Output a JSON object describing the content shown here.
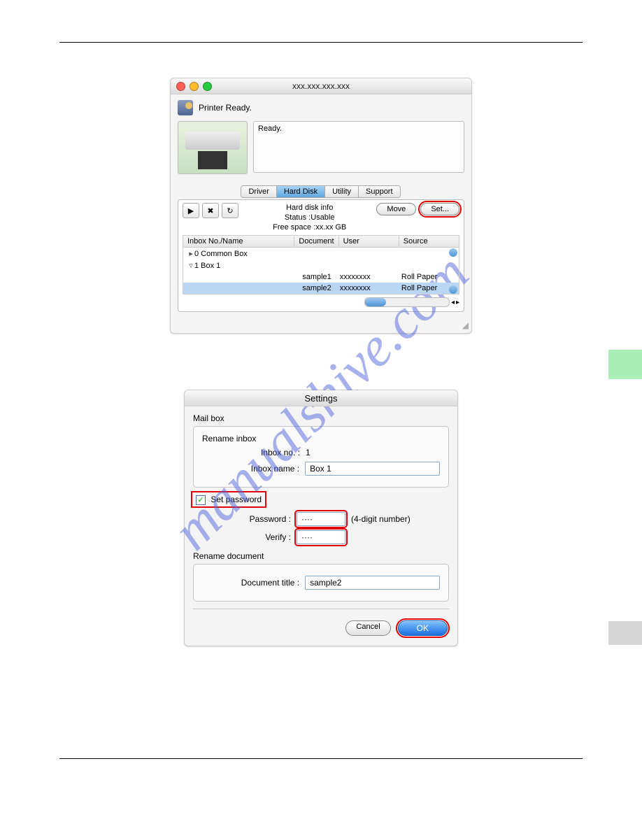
{
  "watermark": "manualshive.com",
  "window1": {
    "title": "xxx.xxx.xxx.xxx",
    "printer_ready_label": "Printer Ready.",
    "ready_box_text": "Ready.",
    "tabs": {
      "driver": "Driver",
      "hard_disk": "Hard Disk",
      "utility": "Utility",
      "support": "Support"
    },
    "hd_info_label": "Hard disk info",
    "status_label": "Status :Usable",
    "free_space_label": "Free space :xx.xx GB",
    "move_btn": "Move",
    "set_btn": "Set...",
    "columns": {
      "c1": "Inbox No./Name",
      "c2": "Document",
      "c3": "User",
      "c4": "Source"
    },
    "rows": {
      "r0_name": "0 Common Box",
      "r1_name": "1 Box 1",
      "r2_doc": "sample1",
      "r2_user": "xxxxxxxx",
      "r2_src": "Roll Paper",
      "r3_doc": "sample2",
      "r3_user": "xxxxxxxx",
      "r3_src": "Roll Paper"
    },
    "toolbar": {
      "play": "▶",
      "clear": "✖",
      "refresh": "↻"
    }
  },
  "settings": {
    "title": "Settings",
    "mailbox_label": "Mail box",
    "rename_inbox_label": "Rename inbox",
    "inbox_no_label": "Inbox no. :",
    "inbox_no_value": "1",
    "inbox_name_label": "Inbox name :",
    "inbox_name_value": "Box 1",
    "set_password_label": "Set password",
    "password_label": "Password :",
    "password_value": "····",
    "password_hint": "(4-digit number)",
    "verify_label": "Verify :",
    "verify_value": "····",
    "rename_doc_label": "Rename document",
    "doc_title_label": "Document title :",
    "doc_title_value": "sample2",
    "cancel_btn": "Cancel",
    "ok_btn": "OK",
    "checkbox_mark": "✓"
  }
}
